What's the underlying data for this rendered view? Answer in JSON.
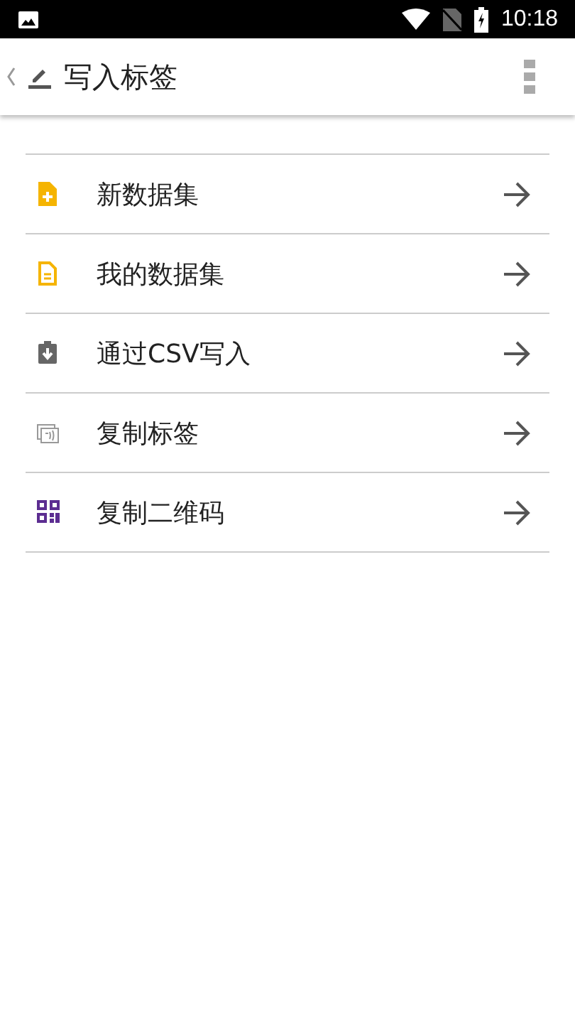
{
  "status_bar": {
    "time": "10:18"
  },
  "toolbar": {
    "title": "写入标签"
  },
  "menu_items": [
    {
      "kind": "new-file",
      "label": "新数据集"
    },
    {
      "kind": "file",
      "label": "我的数据集"
    },
    {
      "kind": "import",
      "label": "通过CSV写入"
    },
    {
      "kind": "nfc",
      "label": "复制标签"
    },
    {
      "kind": "qr",
      "label": "复制二维码"
    }
  ]
}
